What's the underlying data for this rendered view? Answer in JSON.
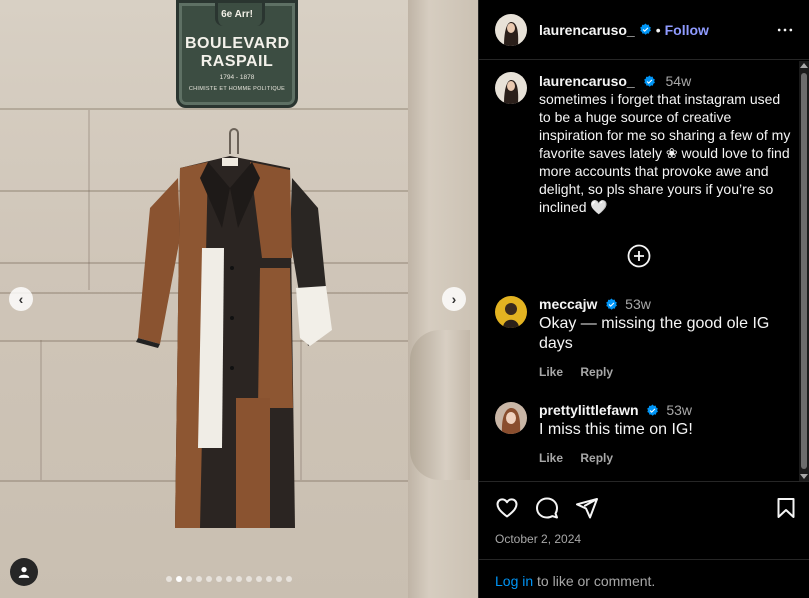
{
  "media": {
    "sign": {
      "arrondissement": "6e Arr!",
      "line1": "BOULEVARD",
      "line2": "RASPAIL",
      "years": "1794 - 1878",
      "subtitle": "CHIMISTE ET HOMME POLITIQUE"
    },
    "prev_icon": "chevron-left-icon",
    "next_icon": "chevron-right-icon",
    "carousel": {
      "total": 13,
      "active_index": 1
    },
    "tag_icon": "user-tag-icon"
  },
  "post": {
    "username": "laurencaruso_",
    "bullet": "•",
    "follow_label": "Follow",
    "more_icon": "more-options-icon"
  },
  "caption": {
    "username": "laurencaruso_",
    "time": "54w",
    "text": "sometimes i forget that instagram used to be a huge source of creative inspiration for me so sharing a few of my favorite saves lately ❀ would love to find more accounts that provoke awe and delight, so pls share yours if you’re so inclined 🤍"
  },
  "comments": [
    {
      "username": "meccajw",
      "time": "53w",
      "text": "Okay — missing the good ole IG days",
      "like_label": "Like",
      "reply_label": "Reply"
    },
    {
      "username": "prettylittlefawn",
      "time": "53w",
      "text": "I miss this time on IG!",
      "like_label": "Like",
      "reply_label": "Reply"
    }
  ],
  "actions": {
    "like_icon": "heart-icon",
    "comment_icon": "comment-icon",
    "share_icon": "share-icon",
    "save_icon": "bookmark-icon",
    "date": "October 2, 2024"
  },
  "login": {
    "link": "Log in",
    "rest": " to like or comment."
  },
  "colors": {
    "accent": "#0095f6",
    "follow": "#8f9bff",
    "verified": "#0095f6",
    "muted": "#a8a8a8"
  }
}
